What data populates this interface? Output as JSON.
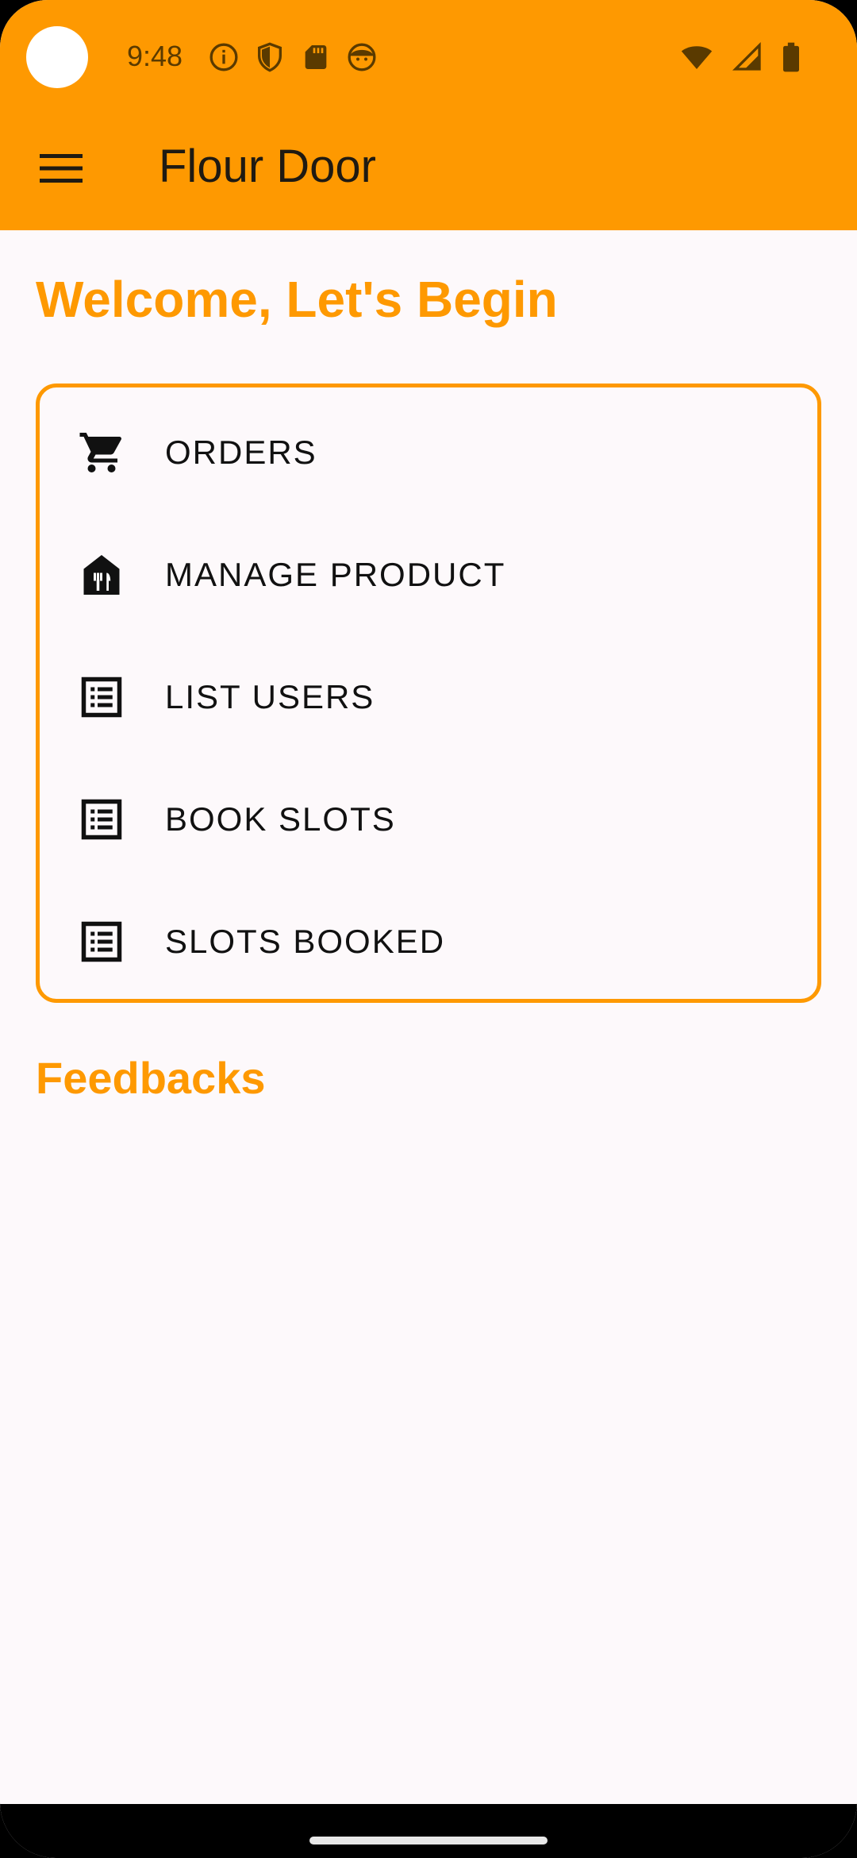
{
  "status_bar": {
    "time": "9:48",
    "left_icons": [
      "info-icon",
      "shield-icon",
      "sd-card-icon",
      "face-icon"
    ],
    "right_icons": [
      "wifi-icon",
      "signal-icon",
      "battery-icon"
    ]
  },
  "app_bar": {
    "title": "Flour Door",
    "menu_icon": "hamburger-menu-icon",
    "color": "#fe9901"
  },
  "main": {
    "welcome": "Welcome, Let's Begin",
    "menu_items": [
      {
        "label": "ORDERS",
        "icon": "cart-icon"
      },
      {
        "label": "MANAGE PRODUCT",
        "icon": "restaurant-icon"
      },
      {
        "label": "LIST USERS",
        "icon": "list-icon"
      },
      {
        "label": "BOOK SLOTS",
        "icon": "list-icon"
      },
      {
        "label": "SLOTS BOOKED",
        "icon": "list-icon"
      }
    ],
    "feedbacks_heading": "Feedbacks"
  },
  "colors": {
    "accent": "#fe9901",
    "background": "#fdf9fb"
  }
}
